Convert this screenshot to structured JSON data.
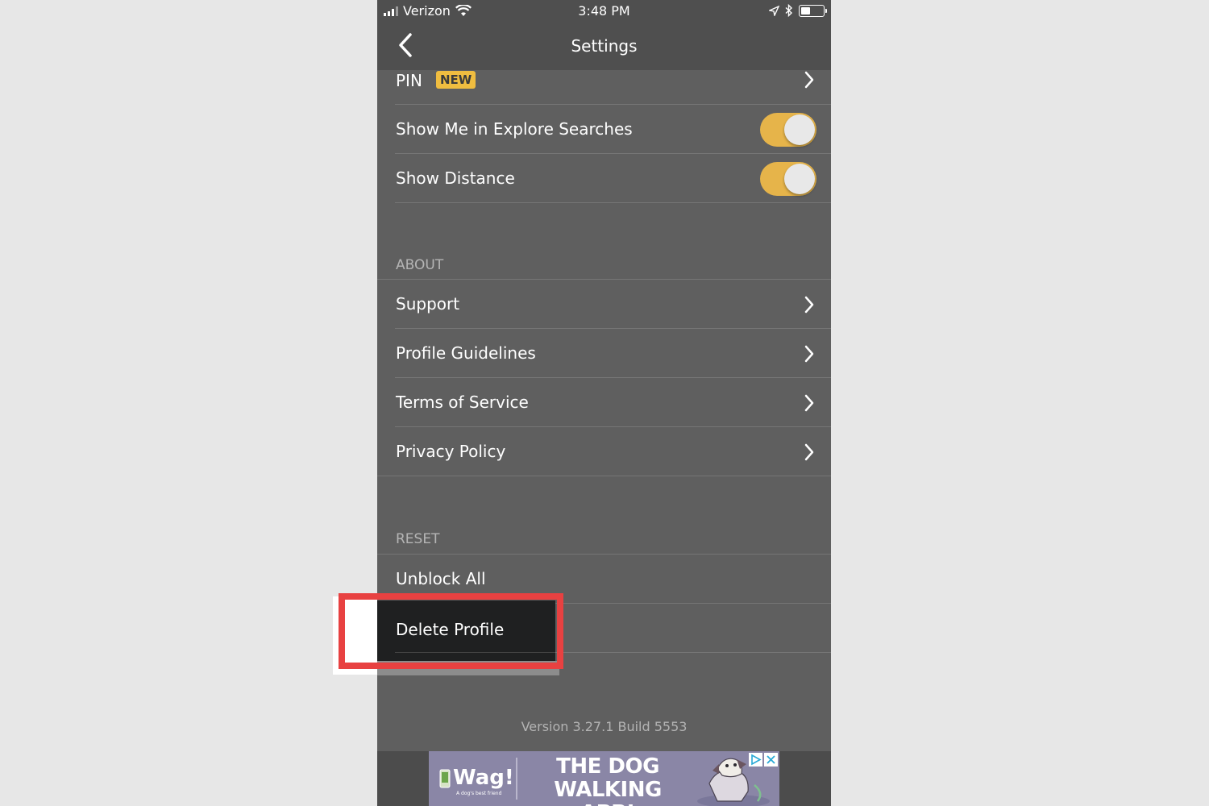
{
  "status_bar": {
    "carrier": "Verizon",
    "time": "3:48 PM"
  },
  "navbar": {
    "title": "Settings"
  },
  "rows": {
    "pin": {
      "label": "PIN",
      "badge": "NEW"
    },
    "explore": {
      "label": "Show Me in Explore Searches",
      "toggle": "on"
    },
    "distance": {
      "label": "Show Distance",
      "toggle": "on"
    }
  },
  "about": {
    "header": "ABOUT",
    "items": [
      {
        "label": "Support"
      },
      {
        "label": "Profile Guidelines"
      },
      {
        "label": "Terms of Service"
      },
      {
        "label": "Privacy Policy"
      }
    ]
  },
  "reset": {
    "header": "RESET",
    "unblock": "Unblock All",
    "delete": "Delete Profile"
  },
  "version": "Version 3.27.1 Build 5553",
  "ad": {
    "brand": "Wag!",
    "tagline": "A dog's best friend",
    "headline_1": "THE DOG",
    "headline_2": "WALKING APP!"
  },
  "colors": {
    "accent": "#e6b44a",
    "highlight": "#e84141",
    "background": "#5f5f5f"
  }
}
